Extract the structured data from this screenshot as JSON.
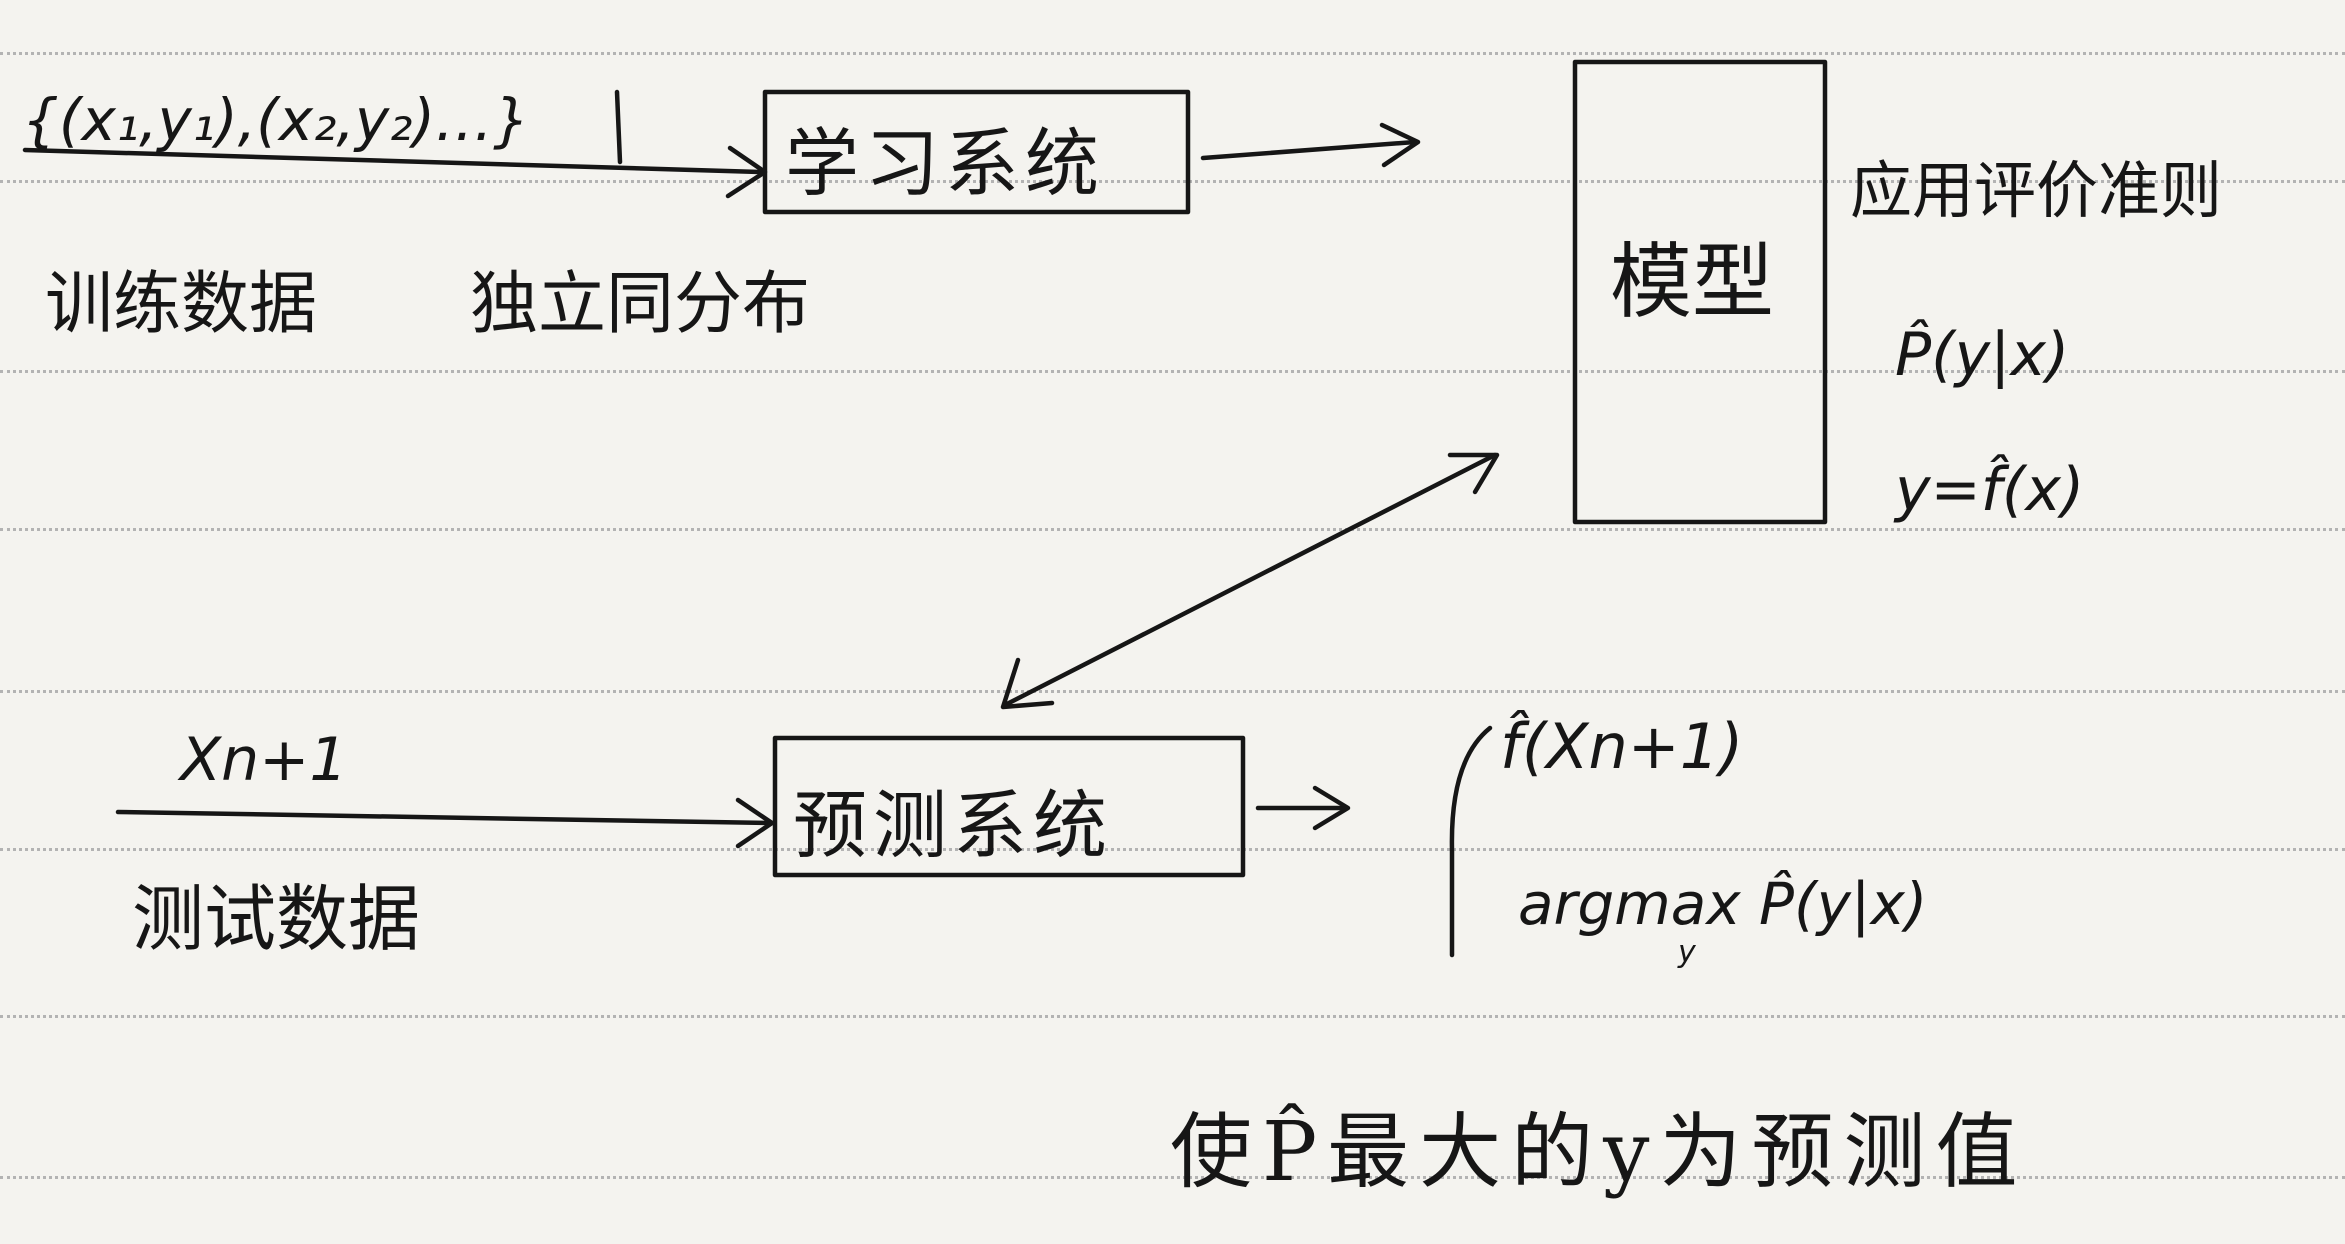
{
  "diagram": {
    "training_sequence": "{(x₁,y₁),(x₂,y₂)…}",
    "training_label": "训练数据",
    "iid_note": "独立同分布",
    "learning_system": "学习系统",
    "model": "模型",
    "model_forms_title": "应用评价准则",
    "model_forms": [
      "P̂(y|x)",
      "y=f̂(x)"
    ],
    "test_input": "Xn+1",
    "test_label": "测试数据",
    "prediction_system": "预测系统",
    "prediction_outputs": [
      "f̂(Xn+1)",
      "argmax P̂(y|x)"
    ],
    "argmax_subscript": "y",
    "prediction_note": "使P̂最大的y为预测值"
  },
  "colors": {
    "ink": "#161616",
    "paper": "#f4f3ef",
    "rule": "#b3b3b3"
  }
}
